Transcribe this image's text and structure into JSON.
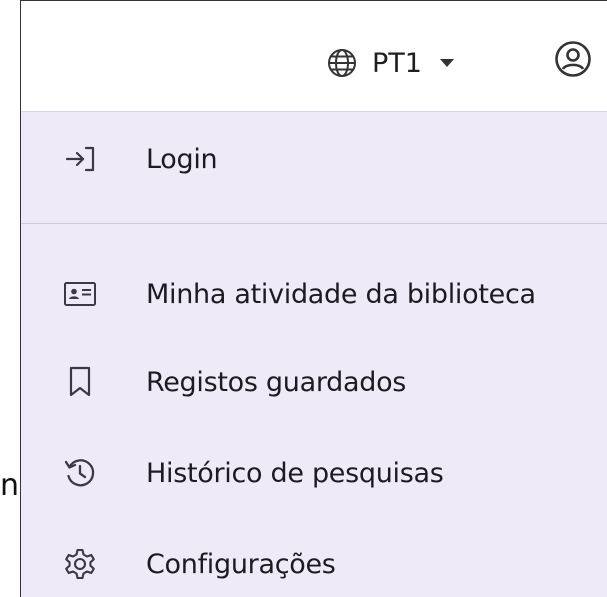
{
  "background_fragment": "n.",
  "header": {
    "language_label": "PT1"
  },
  "menu": {
    "login_label": "Login",
    "items": [
      {
        "label": "Minha atividade da biblioteca",
        "icon": "id-card-icon"
      },
      {
        "label": "Registos guardados",
        "icon": "bookmark-icon"
      },
      {
        "label": "Histórico de pesquisas",
        "icon": "history-icon"
      },
      {
        "label": "Configurações",
        "icon": "gear-icon"
      }
    ]
  },
  "colors": {
    "menu_background": "#efeaf8",
    "text": "#1c1b22",
    "icon": "#3a3944"
  }
}
